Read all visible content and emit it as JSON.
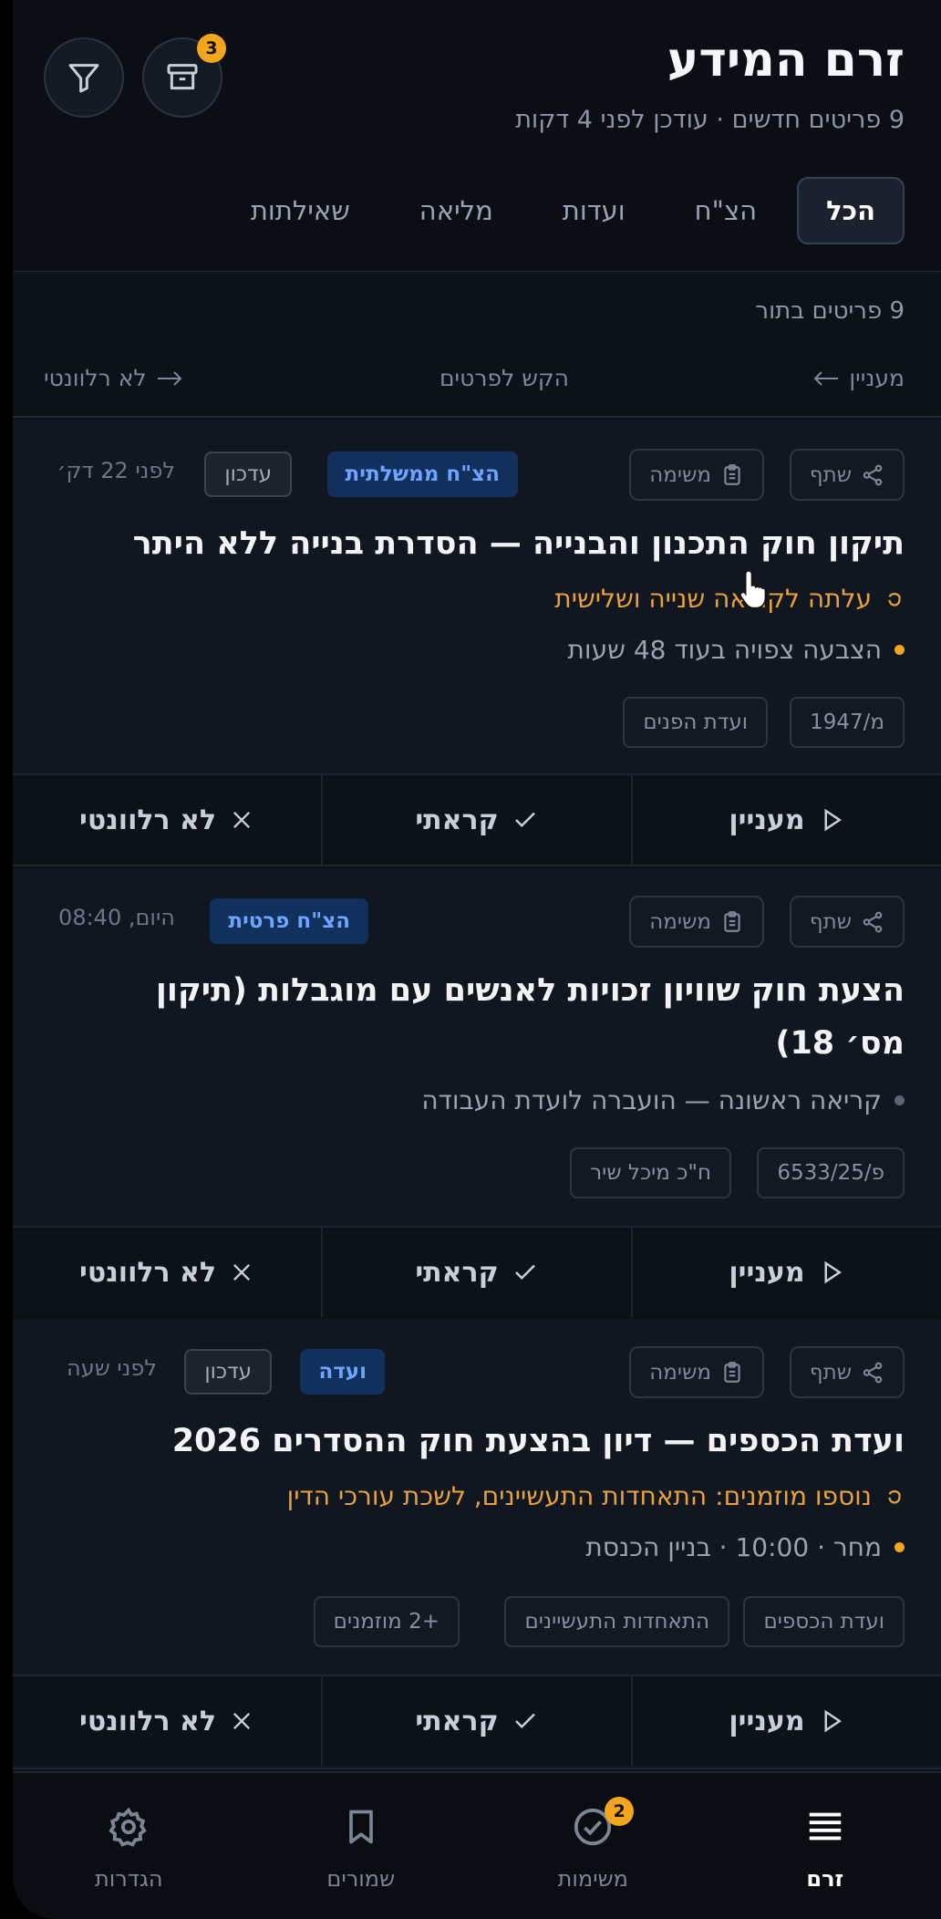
{
  "header": {
    "title": "זרם המידע",
    "subtitle": "9 פריטים חדשים · עודכן לפני 4 דקות",
    "archive_badge": "3"
  },
  "tabs": [
    {
      "label": "הכל",
      "active": true
    },
    {
      "label": "הצ\"ח"
    },
    {
      "label": "ועדות"
    },
    {
      "label": "מליאה"
    },
    {
      "label": "שאילתות"
    }
  ],
  "queue": {
    "count": "9 פריטים בתור",
    "hint_interesting": "מעניין",
    "hint_details": "הקש לפרטים",
    "hint_irrelevant": "לא רלוונטי"
  },
  "card_buttons": {
    "share": "שתף",
    "task": "משימה"
  },
  "card_actions": {
    "interesting": "מעניין",
    "read": "קראתי",
    "irrelevant": "לא רלוונטי"
  },
  "cards": [
    {
      "badge": "הצ\"ח ממשלתית",
      "update": "עדכון",
      "time": "לפני 22 דק׳",
      "title": "תיקון חוק התכנון והבנייה — הסדרת בנייה ללא היתר",
      "status": "עלתה לקריאה שנייה ושלישית",
      "note": "הצבעה צפויה בעוד 48 שעות",
      "tags": [
        "מ/1947",
        "ועדת הפנים"
      ]
    },
    {
      "badge": "הצ\"ח פרטית",
      "time": "היום, 08:40",
      "title_line1": "הצעת חוק שוויון זכויות לאנשים עם מוגבלות (תיקון",
      "title_line2": "מס׳ 18)",
      "note": "קריאה ראשונה — הועברה לועדת העבודה",
      "tags": [
        "פ/6533/25",
        "ח\"כ מיכל שיר"
      ]
    },
    {
      "badge": "ועדה",
      "update": "עדכון",
      "time": "לפני שעה",
      "title": "ועדת הכספים — דיון בהצעת חוק ההסדרים 2026",
      "status": "נוספו מוזמנים: התאחדות התעשיינים, לשכת עורכי הדין",
      "note": "מחר · 10:00 · בניין הכנסת",
      "tags": [
        "ועדת הכספים",
        "התאחדות התעשיינים",
        "+2 מוזמנים"
      ]
    }
  ],
  "nav": [
    {
      "label": "זרם",
      "active": true
    },
    {
      "label": "משימות",
      "badge": "2"
    },
    {
      "label": "שמורים"
    },
    {
      "label": "הגדרות"
    }
  ],
  "colors": {
    "background": "#0d1118",
    "accent_orange": "#e9a03a",
    "badge_blue": "#6ea5ff",
    "badge_yellow": "#f3a51b"
  }
}
